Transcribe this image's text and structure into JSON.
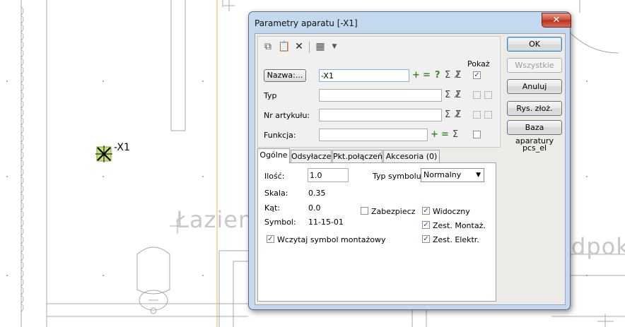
{
  "canvas": {
    "room_label_left": "Łazien",
    "room_label_right": "dpokó",
    "device_label": "-X1"
  },
  "dialog": {
    "title": "Parametry aparatu [-X1]",
    "close_symbol": "✕",
    "toolbar": {
      "icons": [
        "copy-icon",
        "paste-icon",
        "delete-icon",
        "properties-icon",
        "dropdown-arrow-icon"
      ]
    },
    "pokaz_label": "Pokaż",
    "fields": {
      "nazwa_button": "Nazwa:...",
      "nazwa_value": "-X1",
      "typ_label": "Typ",
      "typ_value": "",
      "nr_artykulu_label": "Nr artykułu:",
      "nr_artykulu_value": "",
      "funkcja_label": "Funkcja:",
      "funkcja_value": ""
    },
    "symbols": {
      "plus": "+",
      "minus": "=",
      "question": "?",
      "sigma": "Σ",
      "sigma_check": "Σ̸",
      "check": "✓"
    },
    "tabs": [
      {
        "label": "Ogólne",
        "active": true
      },
      {
        "label": "Odsyłacze",
        "active": false
      },
      {
        "label": "Pkt.połączeń",
        "active": false
      },
      {
        "label": "Akcesoria (0)",
        "active": false
      }
    ],
    "general": {
      "ilosc_label": "Ilość:",
      "ilosc_value": "1.0",
      "typ_symbolu_label": "Typ symbolu",
      "typ_symbolu_value": "Normalny",
      "skala_label": "Skala:",
      "skala_value": "0.35",
      "kat_label": "Kąt:",
      "kat_value": "0.0",
      "symbol_label": "Symbol:",
      "symbol_value": "11-15-01",
      "zabezpiecz_label": "Zabezpiecz",
      "zabezpiecz_checked": false,
      "widoczny_label": "Widoczny",
      "widoczny_checked": true,
      "zest_montaz_label": "Zest. Montaż.",
      "zest_montaz_checked": true,
      "zest_elektr_label": "Zest. Elektr.",
      "zest_elektr_checked": true,
      "wczytaj_label": "Wczytaj symbol montażowy",
      "wczytaj_checked": true
    },
    "buttons": {
      "ok": "OK",
      "wszystkie": "Wszystkie",
      "anuluj": "Anuluj",
      "rys_zloz": "Rys. złoż.",
      "baza_aparatury": "Baza aparatury"
    },
    "library_name": "pcs_el"
  }
}
